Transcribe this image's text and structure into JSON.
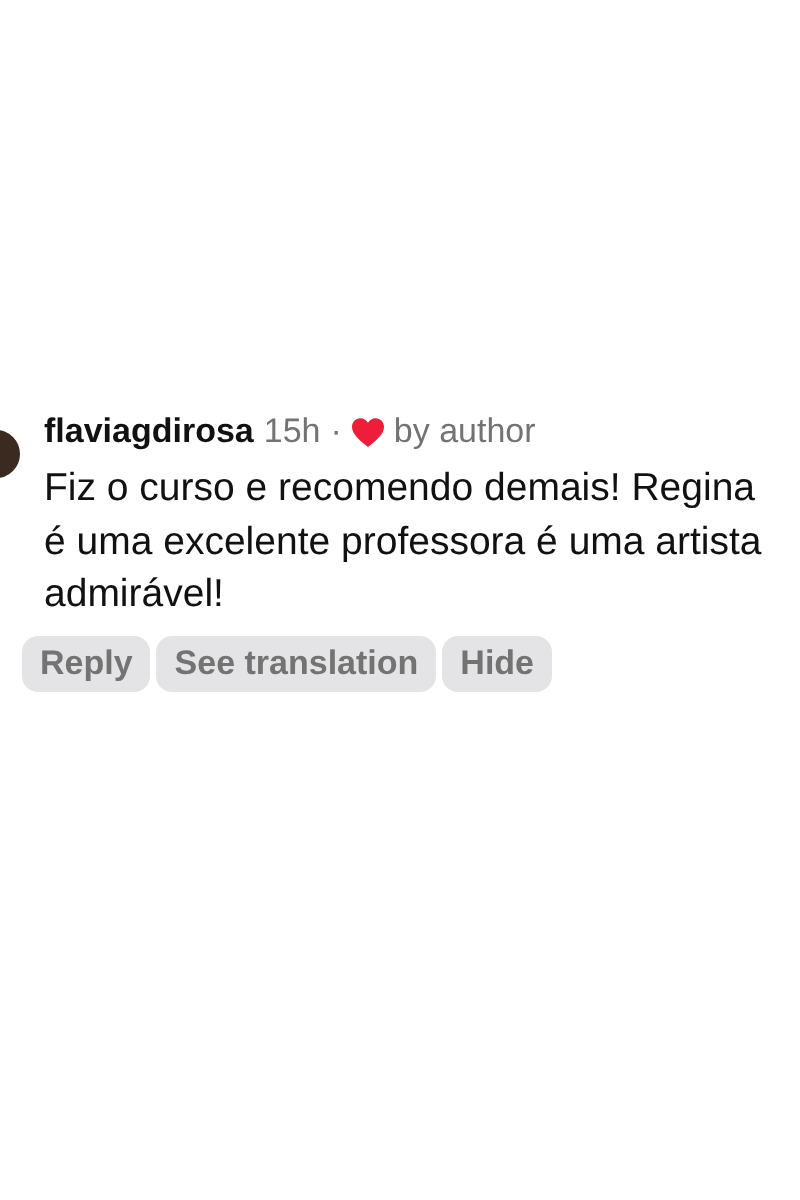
{
  "comment": {
    "username": "flaviagdirosa",
    "time": "15h",
    "separator": "·",
    "liked_by_author": true,
    "liked_label": "by author",
    "text": "Fiz o curso e recomendo demais! Regina é uma excelente professora é uma artista admirável!",
    "actions": [
      "Reply",
      "See translation",
      "Hide"
    ]
  }
}
